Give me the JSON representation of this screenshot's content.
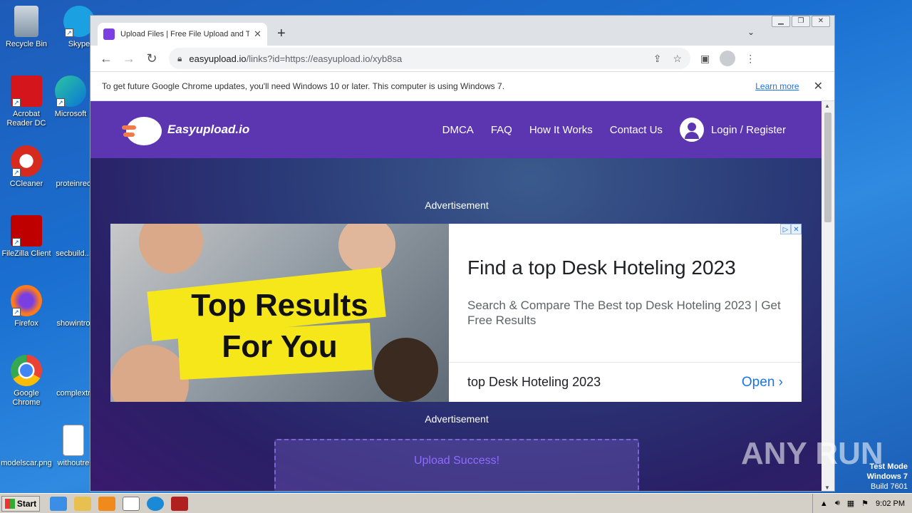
{
  "desktop": {
    "icons": [
      {
        "label": "Recycle Bin"
      },
      {
        "label": "Skype"
      },
      {
        "label": "Acrobat Reader DC"
      },
      {
        "label": "Microsoft"
      },
      {
        "label": "CCleaner"
      },
      {
        "label": "proteinrec"
      },
      {
        "label": "FileZilla Client"
      },
      {
        "label": "secbuild..."
      },
      {
        "label": "Firefox"
      },
      {
        "label": "showintro"
      },
      {
        "label": "Google Chrome"
      },
      {
        "label": "complextr"
      },
      {
        "label": "modelscar.png"
      },
      {
        "label": "withoutre"
      }
    ]
  },
  "browser": {
    "tab_title": "Upload Files | Free File Upload and T",
    "url_domain": "easyupload.io",
    "url_path": "/links?id=https://easyupload.io/xyb8sa",
    "infobar": {
      "message": "To get future Google Chrome updates, you'll need Windows 10 or later. This computer is using Windows 7.",
      "link": "Learn more"
    }
  },
  "site": {
    "logo_text": "Easyupload.io",
    "nav": [
      "DMCA",
      "FAQ",
      "How It Works",
      "Contact Us"
    ],
    "login_label": "Login / Register",
    "ad_label_top": "Advertisement",
    "ad_label_bottom": "Advertisement",
    "ad": {
      "image_text_line1": "Top Results",
      "image_text_line2": "For You",
      "title": "Find a top Desk Hoteling 2023",
      "description": "Search & Compare The Best top Desk Hoteling 2023 | Get Free Results",
      "footer_name": "top Desk Hoteling 2023",
      "cta": "Open"
    },
    "upload_message": "Upload Success!"
  },
  "watermark": "ANY RUN",
  "testmode": {
    "line1": "Test Mode",
    "line2": "Windows 7",
    "line3": "Build 7601"
  },
  "taskbar": {
    "start_label": "Start",
    "clock": "9:02 PM"
  }
}
